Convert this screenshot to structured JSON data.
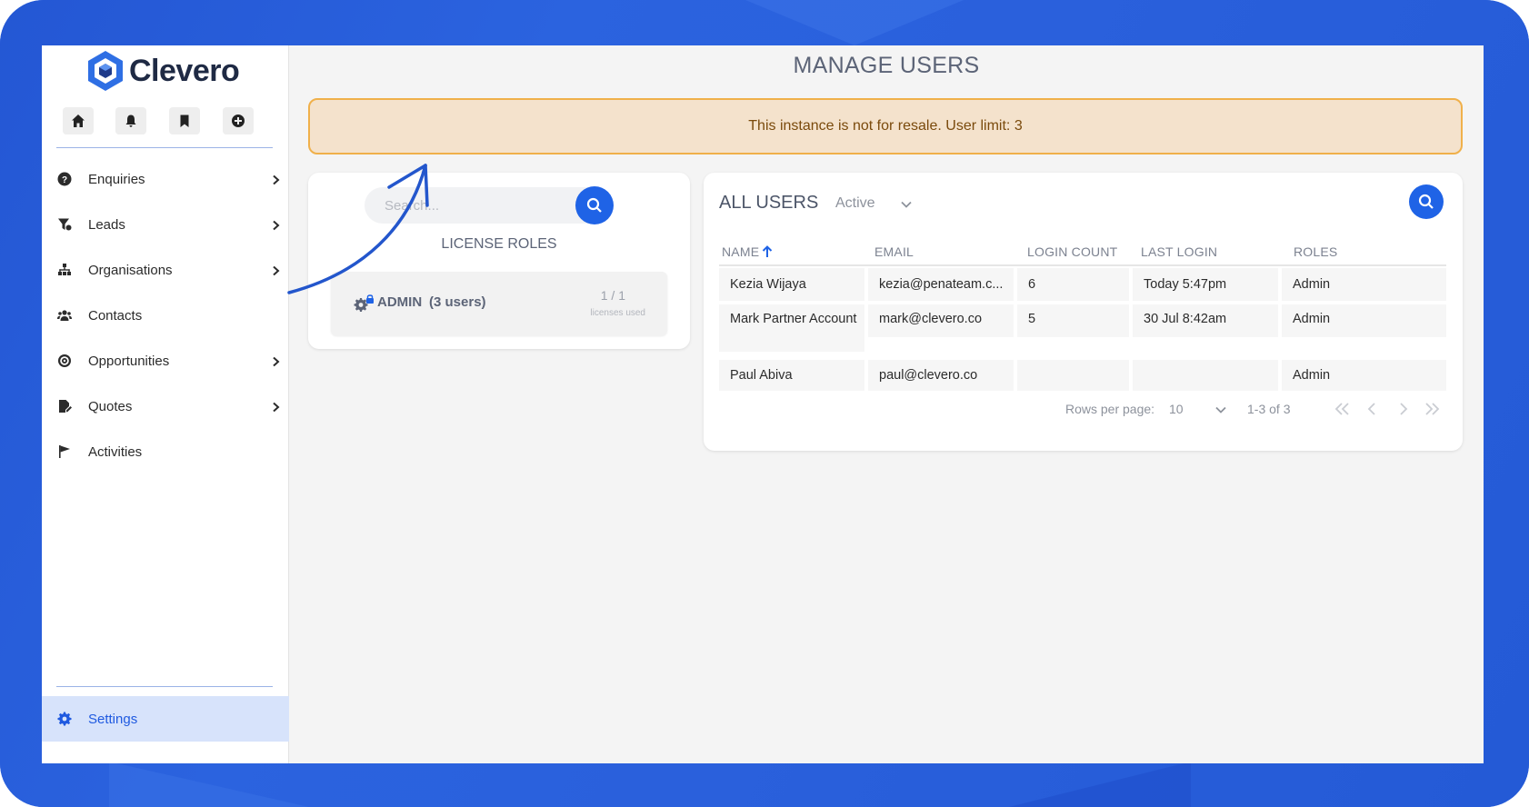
{
  "brand": {
    "name": "Clevero",
    "accent": "#1f63e6"
  },
  "quick_actions": [
    {
      "icon": "home-icon"
    },
    {
      "icon": "bell-icon"
    },
    {
      "icon": "bookmark-icon"
    },
    {
      "icon": "add-circle-icon"
    }
  ],
  "sidebar": {
    "items": [
      {
        "label": "Enquiries",
        "icon": "help-circle-icon",
        "has_submenu": true
      },
      {
        "label": "Leads",
        "icon": "funnel-icon",
        "has_submenu": true
      },
      {
        "label": "Organisations",
        "icon": "org-chart-icon",
        "has_submenu": true
      },
      {
        "label": "Contacts",
        "icon": "people-icon",
        "has_submenu": false
      },
      {
        "label": "Opportunities",
        "icon": "target-icon",
        "has_submenu": true
      },
      {
        "label": "Quotes",
        "icon": "quote-doc-icon",
        "has_submenu": true
      },
      {
        "label": "Activities",
        "icon": "flag-icon",
        "has_submenu": false
      }
    ],
    "settings_label": "Settings"
  },
  "page": {
    "title": "MANAGE USERS",
    "notice": "This instance is not for resale. User limit: 3"
  },
  "license_roles": {
    "search_placeholder": "Search...",
    "title": "LICENSE ROLES",
    "roles": [
      {
        "name": "ADMIN",
        "count_label": "(3 users)",
        "fraction": "1 / 1",
        "used_label": "licenses used"
      }
    ]
  },
  "users": {
    "title": "ALL USERS",
    "filter": "Active",
    "columns": [
      "NAME",
      "EMAIL",
      "LOGIN COUNT",
      "LAST LOGIN",
      "ROLES"
    ],
    "rows": [
      [
        "Kezia Wijaya",
        "kezia@penateam.c...",
        "6",
        "Today 5:47pm",
        "Admin"
      ],
      [
        "Mark Partner Account",
        "mark@clevero.co",
        "5",
        "30 Jul 8:42am",
        "Admin"
      ],
      [
        "Paul Abiva",
        "paul@clevero.co",
        "",
        "",
        "Admin"
      ]
    ],
    "pager": {
      "rows_per_page_label": "Rows per page:",
      "rows_per_page": "10",
      "range": "1-3 of 3"
    }
  }
}
